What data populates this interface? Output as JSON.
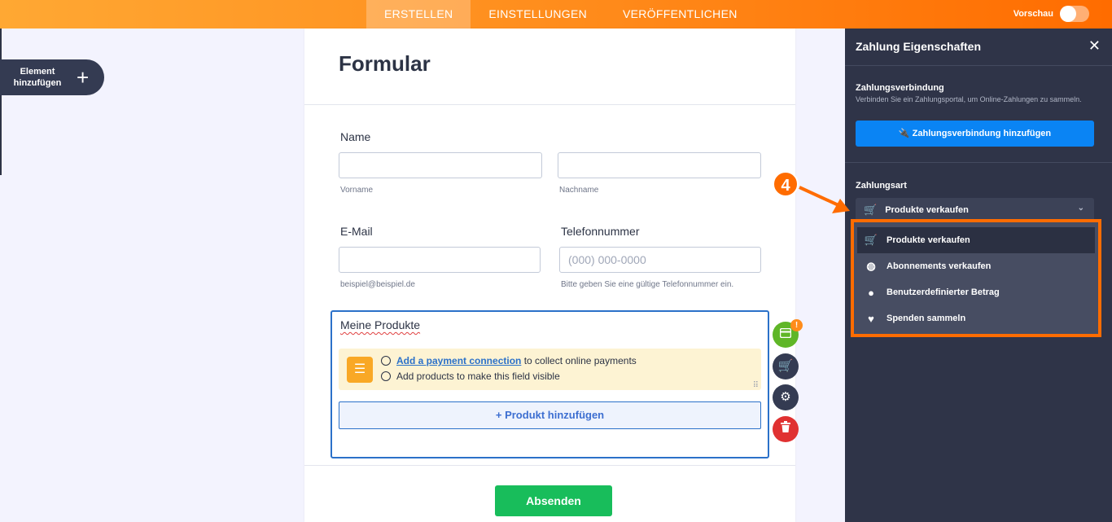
{
  "topbar": {
    "tabs": [
      {
        "label": "ERSTELLEN",
        "active": true
      },
      {
        "label": "EINSTELLUNGEN",
        "active": false
      },
      {
        "label": "VERÖFFENTLICHEN",
        "active": false
      }
    ],
    "preview_label": "Vorschau"
  },
  "left": {
    "add_element_label": "Element hinzufügen",
    "plus": "+"
  },
  "form": {
    "title": "Formular",
    "name": {
      "label": "Name",
      "first_sub": "Vorname",
      "last_sub": "Nachname"
    },
    "email": {
      "label": "E-Mail",
      "sub": "beispiel@beispiel.de"
    },
    "phone": {
      "label": "Telefonnummer",
      "placeholder": "(000) 000-0000",
      "sub": "Bitte geben Sie eine gültige Telefonnummer ein."
    },
    "products": {
      "title": "Meine Produkte",
      "warn_link": "Add a payment connection",
      "warn_line1_rest": "to collect online payments",
      "warn_line2": "Add products to make this field visible",
      "add_button": "+ Produkt hinzufügen"
    },
    "submit": "Absenden"
  },
  "side_actions": {
    "badge": "!"
  },
  "panel": {
    "title": "Zahlung Eigenschaften",
    "close": "✕",
    "connection": {
      "title": "Zahlungsverbindung",
      "desc": "Verbinden Sie ein Zahlungsportal, um Online-Zahlungen zu sammeln.",
      "button": "Zahlungsverbindung hinzufügen"
    },
    "payment_type": {
      "title": "Zahlungsart",
      "selected": "Produkte verkaufen",
      "options": [
        {
          "label": "Produkte verkaufen",
          "icon": "cart-icon",
          "selected": true
        },
        {
          "label": "Abonnements verkaufen",
          "icon": "coins-icon",
          "selected": false
        },
        {
          "label": "Benutzerdefinierter Betrag",
          "icon": "custom-amount-icon",
          "selected": false
        },
        {
          "label": "Spenden sammeln",
          "icon": "heart-icon",
          "selected": false
        }
      ]
    }
  },
  "annotation": {
    "step": "4",
    "color": "#ff6c00"
  },
  "colors": {
    "accent": "#ff8a1a",
    "primary_blue": "#0a84f4",
    "panel_bg": "#2f3448",
    "submit_green": "#18bd5b"
  }
}
